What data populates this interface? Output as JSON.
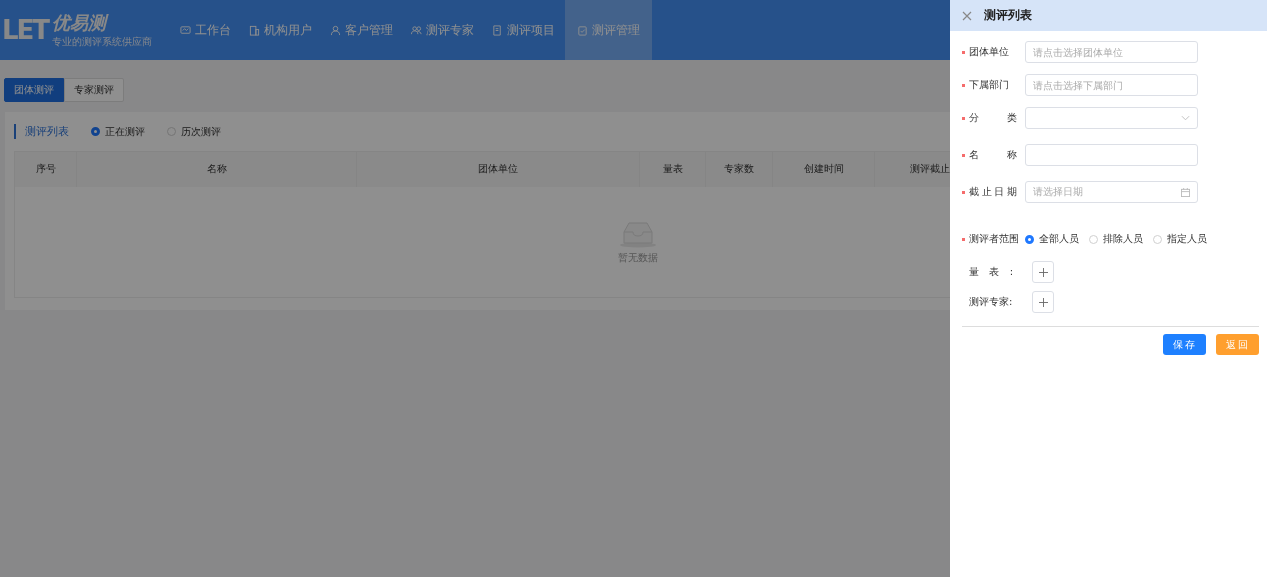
{
  "header": {
    "logo_mark": "LET",
    "brand": "优易测",
    "tagline": "专业的测评系统供应商",
    "nav": [
      {
        "label": "工作台",
        "kind": "monitor",
        "selected": false
      },
      {
        "label": "机构用户",
        "kind": "building",
        "selected": false
      },
      {
        "label": "客户管理",
        "kind": "user",
        "selected": false
      },
      {
        "label": "测评专家",
        "kind": "users",
        "selected": false
      },
      {
        "label": "测评项目",
        "kind": "doc",
        "selected": false
      },
      {
        "label": "测评管理",
        "kind": "clipboard",
        "selected": true
      }
    ]
  },
  "tabs": [
    {
      "label": "团体测评",
      "selected": true
    },
    {
      "label": "专家测评",
      "selected": false
    }
  ],
  "section": {
    "title": "测评列表",
    "filters": [
      {
        "label": "正在测评",
        "selected": true
      },
      {
        "label": "历次测评",
        "selected": false
      }
    ]
  },
  "table": {
    "columns": [
      "序号",
      "名称",
      "团体单位",
      "量表",
      "专家数",
      "创建时间",
      "测评截止"
    ],
    "empty_text": "暂无数据"
  },
  "drawer": {
    "title": "测评列表",
    "fields": [
      {
        "label": "团体单位",
        "required": true,
        "kind": "input",
        "placeholder": "请点击选择团体单位",
        "spread": false
      },
      {
        "label": "下属部门",
        "required": true,
        "kind": "input",
        "placeholder": "请点击选择下属部门",
        "spread": false
      },
      {
        "label": "分类",
        "required": true,
        "kind": "select",
        "spread": true
      },
      {
        "label": "名称",
        "required": true,
        "kind": "input",
        "spread": true
      },
      {
        "label": "截止日期",
        "required": true,
        "kind": "date",
        "placeholder": "请选择日期",
        "spread": true
      },
      {
        "label": "测评者范围",
        "required": true,
        "kind": "radio",
        "options": [
          {
            "label": "全部人员",
            "selected": true
          },
          {
            "label": "排除人员",
            "selected": false
          },
          {
            "label": "指定人员",
            "selected": false
          }
        ],
        "spread": false
      },
      {
        "label": "量表:",
        "required": false,
        "kind": "add",
        "spread": true
      },
      {
        "label": "测评专家:",
        "required": false,
        "kind": "add",
        "spread": false
      }
    ],
    "buttons": [
      {
        "label": "保存",
        "kind": "primary"
      },
      {
        "label": "返回",
        "kind": "warning"
      }
    ]
  }
}
